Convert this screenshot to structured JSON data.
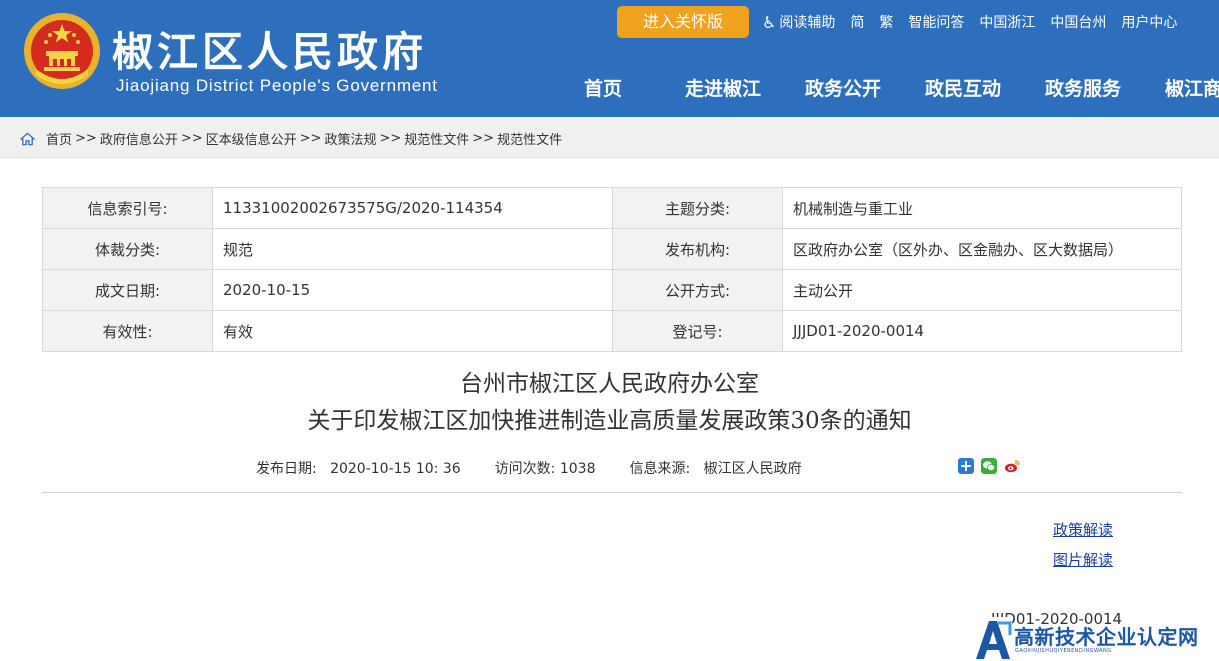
{
  "header": {
    "title_cn": "椒江区人民政府",
    "title_en": "Jiaojiang District People's Government",
    "care_button": "进入关怀版",
    "top_links": [
      "阅读辅助",
      "简",
      "繁",
      "智能问答",
      "中国浙江",
      "中国台州",
      "用户中心"
    ],
    "nav": [
      "首页",
      "走进椒江",
      "政务公开",
      "政民互动",
      "政务服务",
      "椒江商务"
    ]
  },
  "breadcrumb": [
    "首页",
    "政府信息公开",
    "区本级信息公开",
    "政策法规",
    "规范性文件",
    "规范性文件"
  ],
  "breadcrumb_sep": ">>",
  "info": {
    "index_label": "信息索引号:",
    "index_value": "11331002002673575G/2020-114354",
    "topic_label": "主题分类:",
    "topic_value": "机械制造与重工业",
    "genre_label": "体裁分类:",
    "genre_value": "规范",
    "publisher_label": "发布机构:",
    "publisher_value": "区政府办公室（区外办、区金融办、区大数据局）",
    "date_label": "成文日期:",
    "date_value": "2020-10-15",
    "open_label": "公开方式:",
    "open_value": "主动公开",
    "validity_label": "有效性:",
    "validity_value": "有效",
    "reg_label": "登记号:",
    "reg_value": "JJJD01-2020-0014"
  },
  "document": {
    "title_line1": "台州市椒江区人民政府办公室",
    "title_line2": "关于印发椒江区加快推进制造业高质量发展政策30条的通知",
    "publish_label": "发布日期:",
    "publish_value": "2020-10-15 10: 36",
    "visits_label": "访问次数:",
    "visits_value": "1038",
    "source_label": "信息来源:",
    "source_value": "椒江区人民政府",
    "policy_link": "政策解读",
    "image_link": "图片解读",
    "code": "JJJD01-2020-0014"
  },
  "watermark": {
    "cn": "高新技术企业认定网",
    "en": "GAOXINJISHUQIYERENDINGWANG"
  },
  "colors": {
    "header_bg": "#2e6fbd",
    "care_button": "#f0a21f",
    "link": "#1a3f9c"
  },
  "icons": [
    "emblem",
    "accessibility-icon",
    "home-icon",
    "share-plus-icon",
    "wechat-icon",
    "weibo-icon",
    "watermark-logo"
  ]
}
